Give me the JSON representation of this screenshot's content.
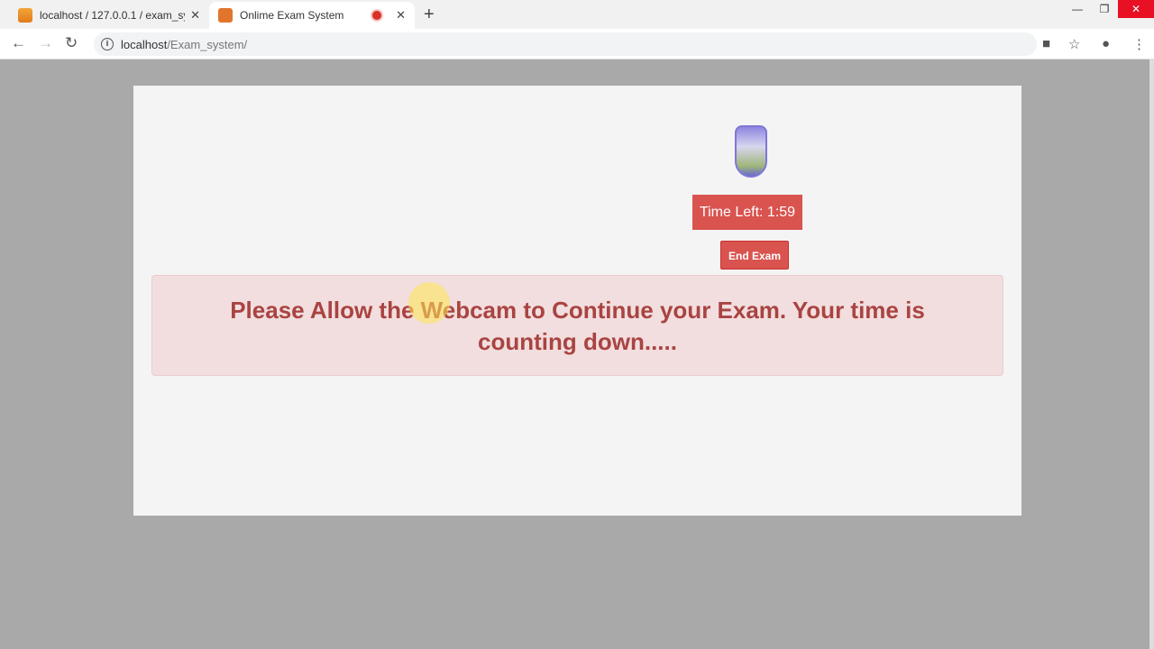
{
  "browser": {
    "tabs": [
      {
        "label": "localhost / 127.0.0.1 / exam_system",
        "icon": "phpmyadmin-icon"
      },
      {
        "label": "Onlime Exam System",
        "icon": "xampp-icon",
        "recording": true
      }
    ],
    "url_host": "localhost",
    "url_path": "/Exam_system/"
  },
  "exam": {
    "timer": "Time Left: 1:59",
    "end_button": "End Exam",
    "alert": "Please Allow the Webcam to Continue your Exam. Your time is counting down....."
  },
  "colors": {
    "danger": "#d9534f",
    "alert_text": "#a94442",
    "alert_bg": "#f2dede"
  }
}
